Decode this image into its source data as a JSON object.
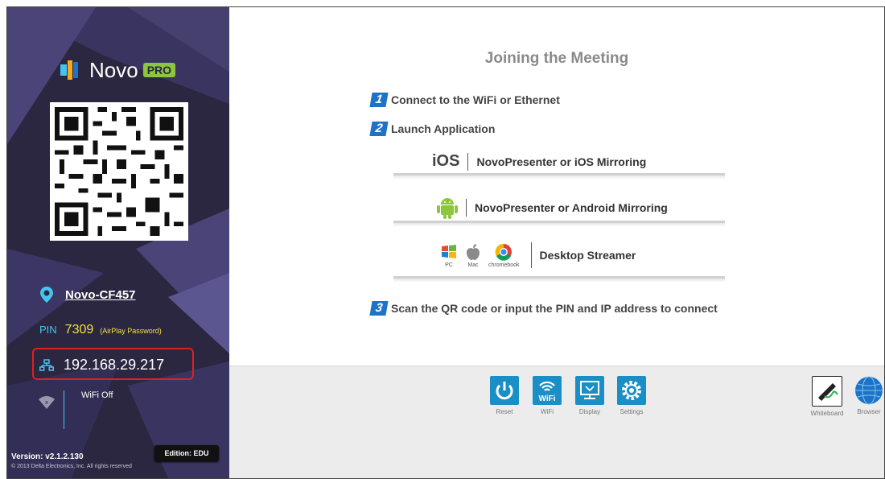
{
  "sidebar": {
    "brand": "Novo",
    "brand_badge": "PRO",
    "ssid": "Novo-CF457",
    "pin_label": "PIN",
    "pin_value": "7309",
    "pin_note": "(AirPlay Password)",
    "ip_address": "192.168.29.217",
    "wifi_status": "WiFi Off",
    "version": "Version: v2.1.2.130",
    "copyright": "© 2013 Delta Electronics, Inc. All rights reserved",
    "edition": "Edition: EDU"
  },
  "main": {
    "title": "Joining the Meeting",
    "steps": [
      {
        "num": "1",
        "text": "Connect to the WiFi  or  Ethernet"
      },
      {
        "num": "2",
        "text": "Launch Application"
      },
      {
        "num": "3",
        "text": "Scan the QR code or input the PIN and IP address to connect"
      }
    ],
    "ios": {
      "os": "iOS",
      "apps": "NovoPresenter  or  iOS Mirroring"
    },
    "android": {
      "apps": "NovoPresenter  or  Android Mirroring"
    },
    "desktop": {
      "platforms": [
        "PC",
        "Mac",
        "chromebook"
      ],
      "apps": "Desktop Streamer"
    }
  },
  "toolbar": {
    "items": [
      {
        "label": "Reset",
        "icon": "power-icon"
      },
      {
        "label": "WiFi",
        "icon": "wifi-icon"
      },
      {
        "label": "Display",
        "icon": "display-icon"
      },
      {
        "label": "Settings",
        "icon": "gear-icon"
      }
    ],
    "apps": [
      {
        "label": "Whiteboard",
        "icon": "whiteboard-icon"
      },
      {
        "label": "Browser",
        "icon": "globe-icon"
      }
    ]
  },
  "colors": {
    "sidebar_bg": "#2b2740",
    "accent_blue": "#1a8fc6",
    "pin_yellow": "#f2e23a",
    "highlight_red": "#e02020",
    "pro_green": "#8cc63e"
  }
}
